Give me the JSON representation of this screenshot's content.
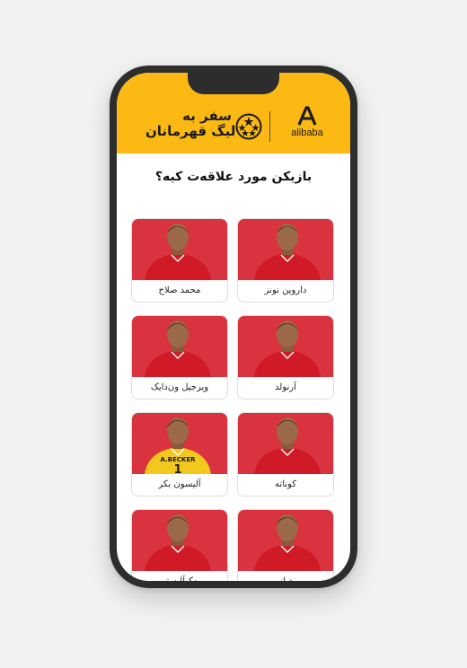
{
  "header": {
    "brand_name": "alibaba",
    "campaign_line1": "سفر به",
    "campaign_line2": "لیگ قهرمانان"
  },
  "question": "بازیکن مورد علاقه‌ت کیه؟",
  "players": [
    {
      "name": "داروین نونز",
      "kit": "red"
    },
    {
      "name": "محمد صلاح",
      "kit": "red"
    },
    {
      "name": "آرنولد",
      "kit": "red"
    },
    {
      "name": "ویرجیل ون‌دایک",
      "kit": "red"
    },
    {
      "name": "کوناته",
      "kit": "red"
    },
    {
      "name": "آلیسون بکر",
      "kit": "yellow",
      "shirt_text": "A.BECKER",
      "shirt_number": "1"
    },
    {
      "name": "دیاز",
      "kit": "red"
    },
    {
      "name": "مک‌آلیستر",
      "kit": "red"
    }
  ],
  "colors": {
    "header": "#fcb913",
    "card_photo": "#d8333e",
    "kit_red": "#d01a26",
    "kit_yellow": "#f1c81b"
  }
}
